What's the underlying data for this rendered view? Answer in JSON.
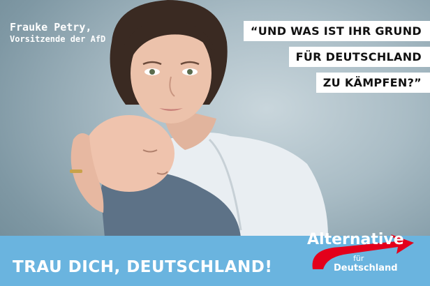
{
  "caption": {
    "name": "Frauke Petry,",
    "role": "Vorsitzende der AfD"
  },
  "quote": {
    "line1": "“UND WAS IST IHR GRUND",
    "line2": "FÜR DEUTSCHLAND",
    "line3": "ZU KÄMPFEN?”"
  },
  "slogan": "TRAU DICH, DEUTSCHLAND!",
  "logo": {
    "word1": "Alternative",
    "word2": "für",
    "word3": "Deutschland"
  },
  "colors": {
    "band": "#6ab4df",
    "logo_red": "#e3001b",
    "background": "#a9bcc5"
  }
}
